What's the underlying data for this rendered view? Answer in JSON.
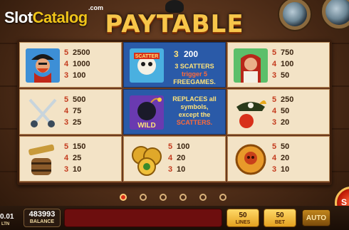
{
  "watermark": {
    "slot": "Slot",
    "catalog": "Catalog",
    "dotcom": ".com"
  },
  "title": "PAYTABLE",
  "paytable": [
    {
      "symbol": "pirate-captain",
      "pays": [
        {
          "count": "5",
          "value": "2500"
        },
        {
          "count": "4",
          "value": "1000"
        },
        {
          "count": "3",
          "value": "100"
        }
      ]
    },
    {
      "symbol": "scatter-skull",
      "special": "scatter"
    },
    {
      "symbol": "pirate-woman",
      "pays": [
        {
          "count": "5",
          "value": "750"
        },
        {
          "count": "4",
          "value": "100"
        },
        {
          "count": "3",
          "value": "50"
        }
      ]
    },
    {
      "symbol": "crossed-sabres",
      "pays": [
        {
          "count": "5",
          "value": "500"
        },
        {
          "count": "4",
          "value": "75"
        },
        {
          "count": "3",
          "value": "25"
        }
      ]
    },
    {
      "symbol": "wild-bomb",
      "special": "wild"
    },
    {
      "symbol": "pirate-hat-parrot",
      "pays": [
        {
          "count": "5",
          "value": "250"
        },
        {
          "count": "4",
          "value": "50"
        },
        {
          "count": "3",
          "value": "20"
        }
      ]
    },
    {
      "symbol": "spyglass-barrel",
      "pays": [
        {
          "count": "5",
          "value": "150"
        },
        {
          "count": "4",
          "value": "25"
        },
        {
          "count": "3",
          "value": "10"
        }
      ]
    },
    {
      "symbol": "gold-coins",
      "pays": [
        {
          "count": "5",
          "value": "100"
        },
        {
          "count": "4",
          "value": "20"
        },
        {
          "count": "3",
          "value": "10"
        }
      ]
    },
    {
      "symbol": "skull-coin",
      "pays": [
        {
          "count": "5",
          "value": "50"
        },
        {
          "count": "4",
          "value": "20"
        },
        {
          "count": "3",
          "value": "10"
        }
      ]
    }
  ],
  "scatter": {
    "label": "SCATTER",
    "count": "3",
    "pay": "200",
    "line1": "3 SCATTERS",
    "line2": "trigger 5",
    "line3": "FREEGAMES."
  },
  "wild": {
    "label": "WILD",
    "line1": "REPLACES all",
    "line2": "symbols,",
    "line3": "except the",
    "line4": "SCATTERS."
  },
  "pagination": {
    "pages": 6,
    "active": 0
  },
  "bottom": {
    "bet_per_line_value": "0.01",
    "bet_per_line_label": "LTN",
    "balance_value": "483993",
    "balance_label": "BALANCE",
    "lines_value": "50",
    "lines_label": "LINES",
    "bet_value": "50",
    "bet_label": "BET",
    "auto_label": "AUTO",
    "spin_label": "S"
  },
  "colors": {
    "title": "#f7c64a",
    "pay_count": "#c43b1e",
    "special_cell": "#2a5aa8",
    "message_bar": "#6d0e0e"
  }
}
